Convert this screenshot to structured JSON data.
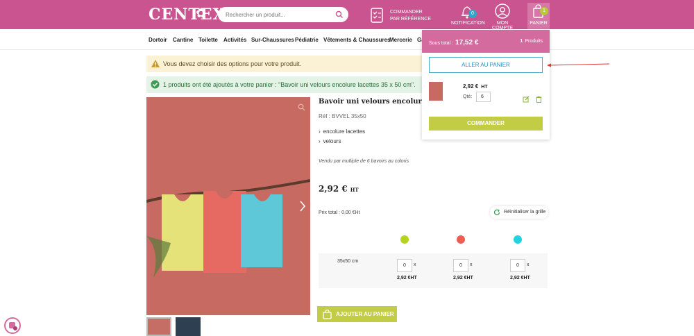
{
  "brand": {
    "logo": "CENTEX"
  },
  "search": {
    "placeholder": "Rechercher un produit..."
  },
  "header": {
    "command_ref": "COMMANDER PAR RÉFÉRENCE",
    "notification_label": "NOTIFICATION",
    "notification_count": "0",
    "account_label": "MON COMPTE",
    "cart_label": "PANIER",
    "cart_count": "1"
  },
  "nav": [
    "Dortoir",
    "Cantine",
    "Toilette",
    "Activités",
    "Sur-Chaussures",
    "Pédiatrie",
    "Vêtements & Chaussures",
    "Mercerie",
    "Ga"
  ],
  "alerts": {
    "warning": "Vous devez choisir des options pour votre produit.",
    "success": "1 produits ont été ajoutés à votre panier : \"Bavoir uni velours encolure lacettes 35 x 50 cm\"."
  },
  "product": {
    "title": "Bavoir uni velours encolure lacettes",
    "ref": "Réf : BVVEL 35x50",
    "features": [
      "encolure lacettes",
      "velours"
    ],
    "sold_by": "Vendu par multiple de 6 bavoirs au coloris",
    "price": "2,92 €",
    "price_unit": "HT",
    "total": "Prix total : 0,00 €Ht",
    "reset": "Réinitialiser la grille",
    "size": "35x50 cm",
    "variants": [
      {
        "color": "#b4d21f",
        "qty": "0",
        "price": "2,92 €HT"
      },
      {
        "color": "#ee5d52",
        "qty": "0",
        "price": "2,92 €HT"
      },
      {
        "color": "#21d3e0",
        "qty": "0",
        "price": "2,92 €HT"
      }
    ],
    "qty_x": "x",
    "add_to_cart": "AJOUTER AU PANIER"
  },
  "cart_popup": {
    "subtotal_label": "Sous total :",
    "subtotal": "17,52 €",
    "count": "1",
    "count_label": "Produits",
    "go_cart": "ALLER AU PANIER",
    "item_price": "2,92 €",
    "item_unit": "HT",
    "qty_label": "Qté:",
    "qty": "6",
    "order": "COMMANDER"
  },
  "colors": {
    "brand": "#c9548f",
    "accent_green": "#c2cc45",
    "link_blue": "#2a8cb6"
  }
}
